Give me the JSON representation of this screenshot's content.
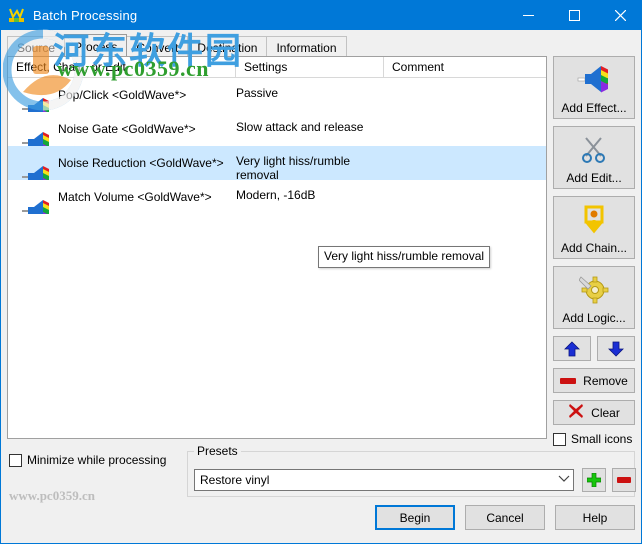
{
  "window": {
    "title": "Batch Processing",
    "icon": "goldwave-logo-icon",
    "minimize_label": "—",
    "maximize_label": "☐",
    "close_label": "✕",
    "accent_color": "#0078d7"
  },
  "tabs": [
    {
      "label": "Source",
      "selected": false,
      "dim": true
    },
    {
      "label": "Process",
      "selected": true,
      "dim": false
    },
    {
      "label": "Convert",
      "selected": false,
      "dim": false
    },
    {
      "label": "Destination",
      "selected": false,
      "dim": false
    },
    {
      "label": "Information",
      "selected": false,
      "dim": false
    }
  ],
  "list": {
    "columns": [
      "Effect, Chain, or Edit",
      "Settings",
      "Comment"
    ],
    "rows": [
      {
        "icon": "speaker-effect-icon",
        "name": "Pop/Click <GoldWave*>",
        "settings": "Passive",
        "comment": "",
        "selected": false
      },
      {
        "icon": "speaker-effect-icon",
        "name": "Noise Gate <GoldWave*>",
        "settings": "Slow attack and release",
        "comment": "",
        "selected": false
      },
      {
        "icon": "speaker-effect-icon",
        "name": "Noise Reduction <GoldWave*>",
        "settings": "Very light hiss/rumble\nremoval",
        "comment": "",
        "selected": true
      },
      {
        "icon": "speaker-effect-icon",
        "name": "Match Volume <GoldWave*>",
        "settings": "Modern, -16dB",
        "comment": "",
        "selected": false
      }
    ]
  },
  "tooltip": {
    "text": "Very light hiss/rumble removal"
  },
  "sidepanel": {
    "buttons": [
      {
        "label": "Add Effect...",
        "icon": "speaker-effect-icon",
        "accesskey": "c"
      },
      {
        "label": "Add Edit...",
        "icon": "scissors-icon",
        "accesskey": "A"
      },
      {
        "label": "Add Chain...",
        "icon": "chain-node-icon",
        "accesskey": "C"
      },
      {
        "label": "Add Logic...",
        "icon": "gear-icon",
        "accesskey": "L"
      }
    ],
    "move_up_label": "↑",
    "move_down_label": "↓",
    "remove_label": "Remove",
    "clear_label": "Clear",
    "small_icons_label": "Small icons",
    "small_icons_checked": false
  },
  "bottom": {
    "minimize_while_processing_label": "Minimize while processing",
    "minimize_while_processing_checked": false,
    "presets_legend": "Presets",
    "preset_value": "Restore vinyl",
    "preset_placeholder": "Restore vinyl",
    "add_preset_label": "+",
    "remove_preset_label": "−",
    "begin_label": "Begin",
    "cancel_label": "Cancel",
    "help_label": "Help"
  },
  "watermark": {
    "cn_text": "河东软件园",
    "url_text": "www.pc0359.cn",
    "url_text_bottom": "www.pc0359.cn"
  }
}
